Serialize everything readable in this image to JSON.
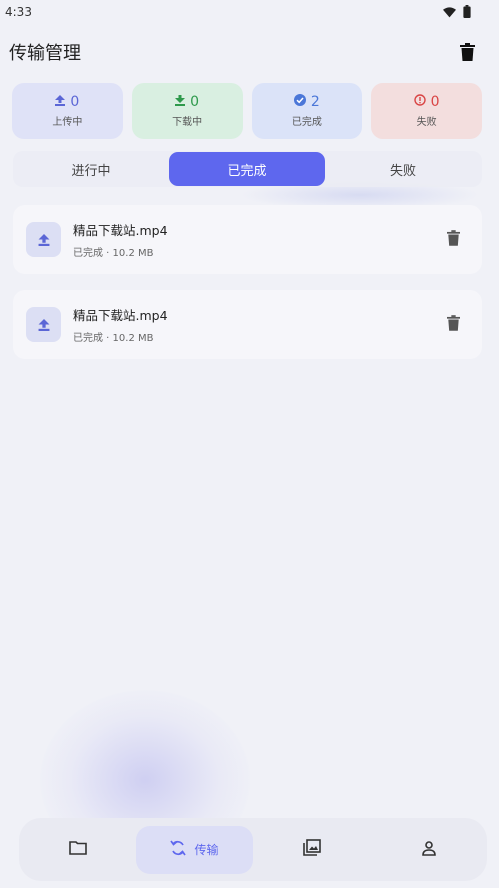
{
  "status_bar": {
    "time": "4:33",
    "wifi_icon": "wifi-icon",
    "battery_icon": "battery-icon"
  },
  "header": {
    "title": "传输管理",
    "clear_icon": "trash-icon"
  },
  "stats": [
    {
      "key": "upload",
      "count": "0",
      "label": "上传中",
      "icon": "upload-arrow-icon",
      "color": "#5b66d6"
    },
    {
      "key": "download",
      "count": "0",
      "label": "下载中",
      "icon": "download-arrow-icon",
      "color": "#2e9a4c"
    },
    {
      "key": "done",
      "count": "2",
      "label": "已完成",
      "icon": "check-circle-icon",
      "color": "#4b77d8"
    },
    {
      "key": "fail",
      "count": "0",
      "label": "失败",
      "icon": "alert-circle-icon",
      "color": "#d94545"
    }
  ],
  "tabs": [
    {
      "label": "进行中",
      "active": false
    },
    {
      "label": "已完成",
      "active": true
    },
    {
      "label": "失败",
      "active": false
    }
  ],
  "files": [
    {
      "name": "精品下载站.mp4",
      "meta": "已完成 · 10.2 MB",
      "icon": "upload-icon"
    },
    {
      "name": "精品下载站.mp4",
      "meta": "已完成 · 10.2 MB",
      "icon": "upload-icon"
    }
  ],
  "bottom_nav": [
    {
      "key": "files",
      "label": "",
      "icon": "folder-icon",
      "active": false
    },
    {
      "key": "transfer",
      "label": "传输",
      "icon": "sync-icon",
      "active": true
    },
    {
      "key": "gallery",
      "label": "",
      "icon": "gallery-icon",
      "active": false
    },
    {
      "key": "profile",
      "label": "",
      "icon": "person-icon",
      "active": false
    }
  ],
  "colors": {
    "accent": "#5e67ee",
    "background": "#f0f1f7"
  }
}
